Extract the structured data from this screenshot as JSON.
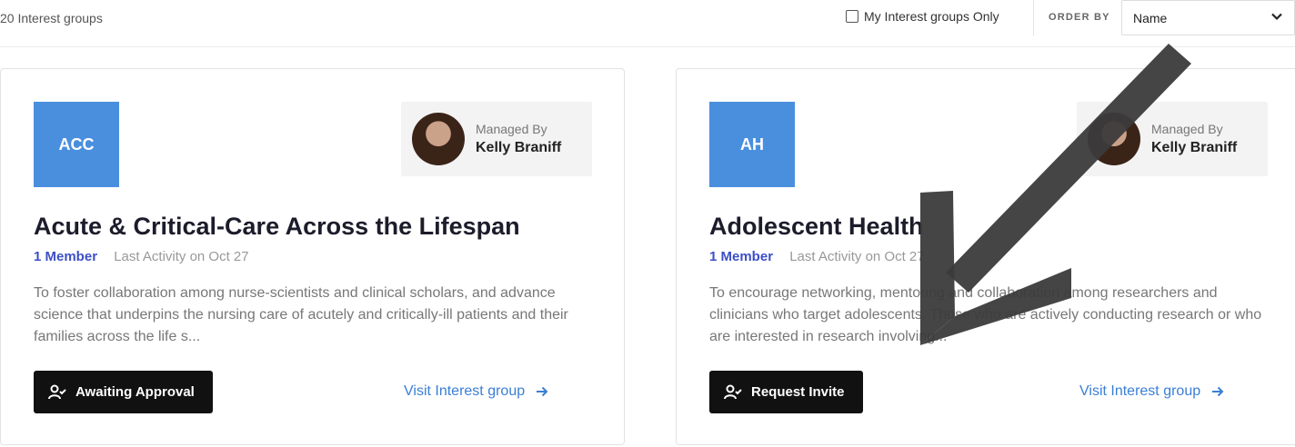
{
  "toolbar": {
    "count_text": "20 Interest groups",
    "filter_label": "My Interest groups Only",
    "order_by_label": "ORDER BY",
    "order_by_value": "Name"
  },
  "cards": [
    {
      "initials": "ACC",
      "managed_by_label": "Managed By",
      "manager_name": "Kelly Braniff",
      "title": "Acute & Critical-Care Across the Lifespan",
      "members": "1 Member",
      "activity": "Last Activity on Oct 27",
      "description": "To foster collaboration among nurse-scientists and clinical scholars, and advance science that underpins the nursing care of acutely and critically-ill patients and their families across the life s...",
      "action_label": "Awaiting Approval",
      "visit_label": "Visit Interest group"
    },
    {
      "initials": "AH",
      "managed_by_label": "Managed By",
      "manager_name": "Kelly Braniff",
      "title": "Adolescent Health",
      "members": "1 Member",
      "activity": "Last Activity on Oct 27",
      "description": "To encourage networking, mentoring and collaboration among researchers and clinicians who target adolescents. Those who are actively conducting research or who are interested in research involving...",
      "action_label": "Request Invite",
      "visit_label": "Visit Interest group"
    }
  ],
  "colors": {
    "tile": "#4a8fde",
    "member_link": "#3d4fc7",
    "visit_link": "#3a7fd4",
    "overlay_arrow": "#3b3b3b"
  }
}
